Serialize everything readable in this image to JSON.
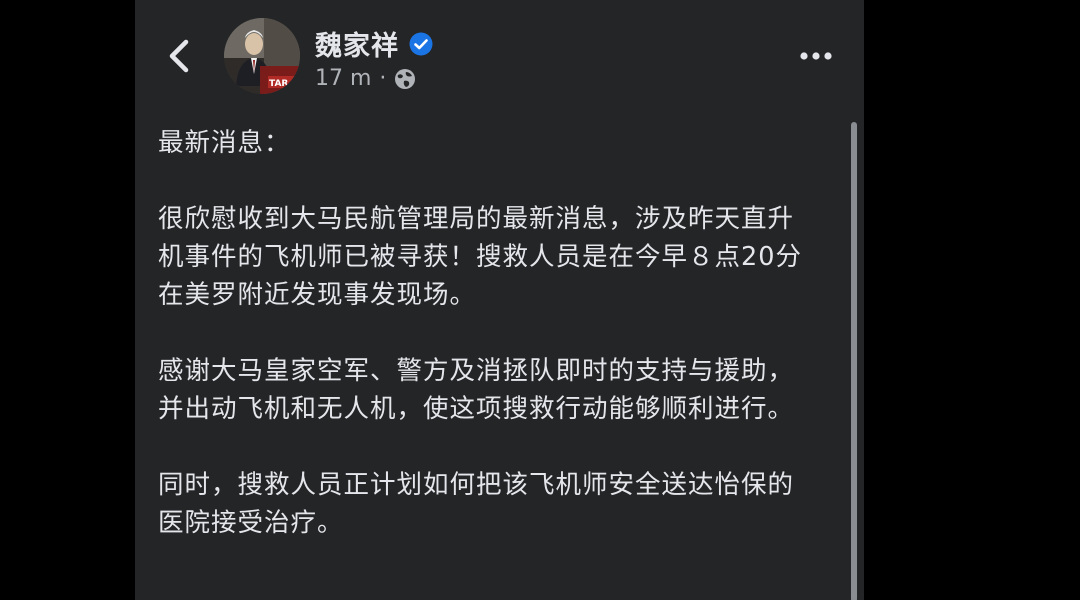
{
  "post": {
    "author": "魏家祥",
    "verified": true,
    "time": "17 m",
    "separator": "·",
    "audience_icon": "globe-icon",
    "avatar_sign_text": "TAR",
    "paragraphs": [
      "最新消息：",
      "很欣慰收到大马民航管理局的最新消息，涉及昨天直升机事件的飞机师已被寻获！搜救人员是在今早８点20分在美罗附近发现事发现场。",
      "感谢大马皇家空军、警方及消拯队即时的支持与援助，并出动飞机和无人机，使这项搜救行动能够顺利进行。",
      "同时，搜救人员正计划如何把该飞机师安全送达怡保的医院接受治疗。"
    ]
  },
  "colors": {
    "background": "#242526",
    "text": "#e4e6eb",
    "secondary_text": "#b0b3b8",
    "verified_badge": "#1b74e4"
  }
}
